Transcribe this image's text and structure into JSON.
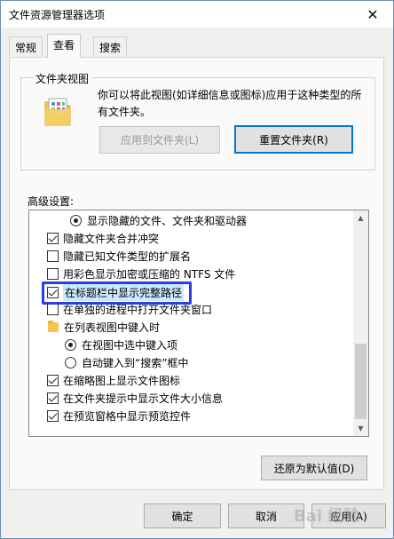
{
  "window": {
    "title": "文件资源管理器选项",
    "close_glyph": "✕"
  },
  "tabs": [
    {
      "label": "常规",
      "active": false
    },
    {
      "label": "查看",
      "active": true
    },
    {
      "label": "搜索",
      "active": false
    }
  ],
  "folder_views": {
    "title": "文件夹视图",
    "description": "你可以将此视图(如详细信息或图标)应用于这种类型的所有文件夹。",
    "apply_button": "应用到文件夹(L)",
    "reset_button": "重置文件夹(R)"
  },
  "advanced": {
    "label": "高级设置:",
    "items": [
      {
        "kind": "radio",
        "checked": true,
        "label": "显示隐藏的文件、文件夹和驱动器",
        "indent": 1
      },
      {
        "kind": "checkbox",
        "checked": true,
        "label": "隐藏文件夹合并冲突",
        "indent": 0
      },
      {
        "kind": "checkbox",
        "checked": false,
        "label": "隐藏已知文件类型的扩展名",
        "indent": 0
      },
      {
        "kind": "checkbox",
        "checked": false,
        "label": "用彩色显示加密或压缩的 NTFS 文件",
        "indent": 0
      },
      {
        "kind": "checkbox",
        "checked": true,
        "label": "在标题栏中显示完整路径",
        "indent": 0,
        "selected": true
      },
      {
        "kind": "checkbox",
        "checked": false,
        "label": "在单独的进程中打开文件夹窗口",
        "indent": 0
      },
      {
        "kind": "folder",
        "checked": false,
        "label": "在列表视图中键入时",
        "indent": 0
      },
      {
        "kind": "radio",
        "checked": true,
        "label": "在视图中选中键入项",
        "indent": 1
      },
      {
        "kind": "radio",
        "checked": false,
        "label": "自动键入到“搜索”框中",
        "indent": 1
      },
      {
        "kind": "checkbox",
        "checked": true,
        "label": "在缩略图上显示文件图标",
        "indent": 0
      },
      {
        "kind": "checkbox",
        "checked": true,
        "label": "在文件夹提示中显示文件大小信息",
        "indent": 0
      },
      {
        "kind": "checkbox",
        "checked": true,
        "label": "在预览窗格中显示预览控件",
        "indent": 0
      }
    ],
    "restore_button": "还原为默认值(D)"
  },
  "footer": {
    "ok": "确定",
    "cancel": "取消",
    "apply": "应用(A)"
  },
  "watermark": "Bai 经验",
  "colors": {
    "highlight_border": "#2c3ee0",
    "focus_blue": "#0078d7"
  }
}
